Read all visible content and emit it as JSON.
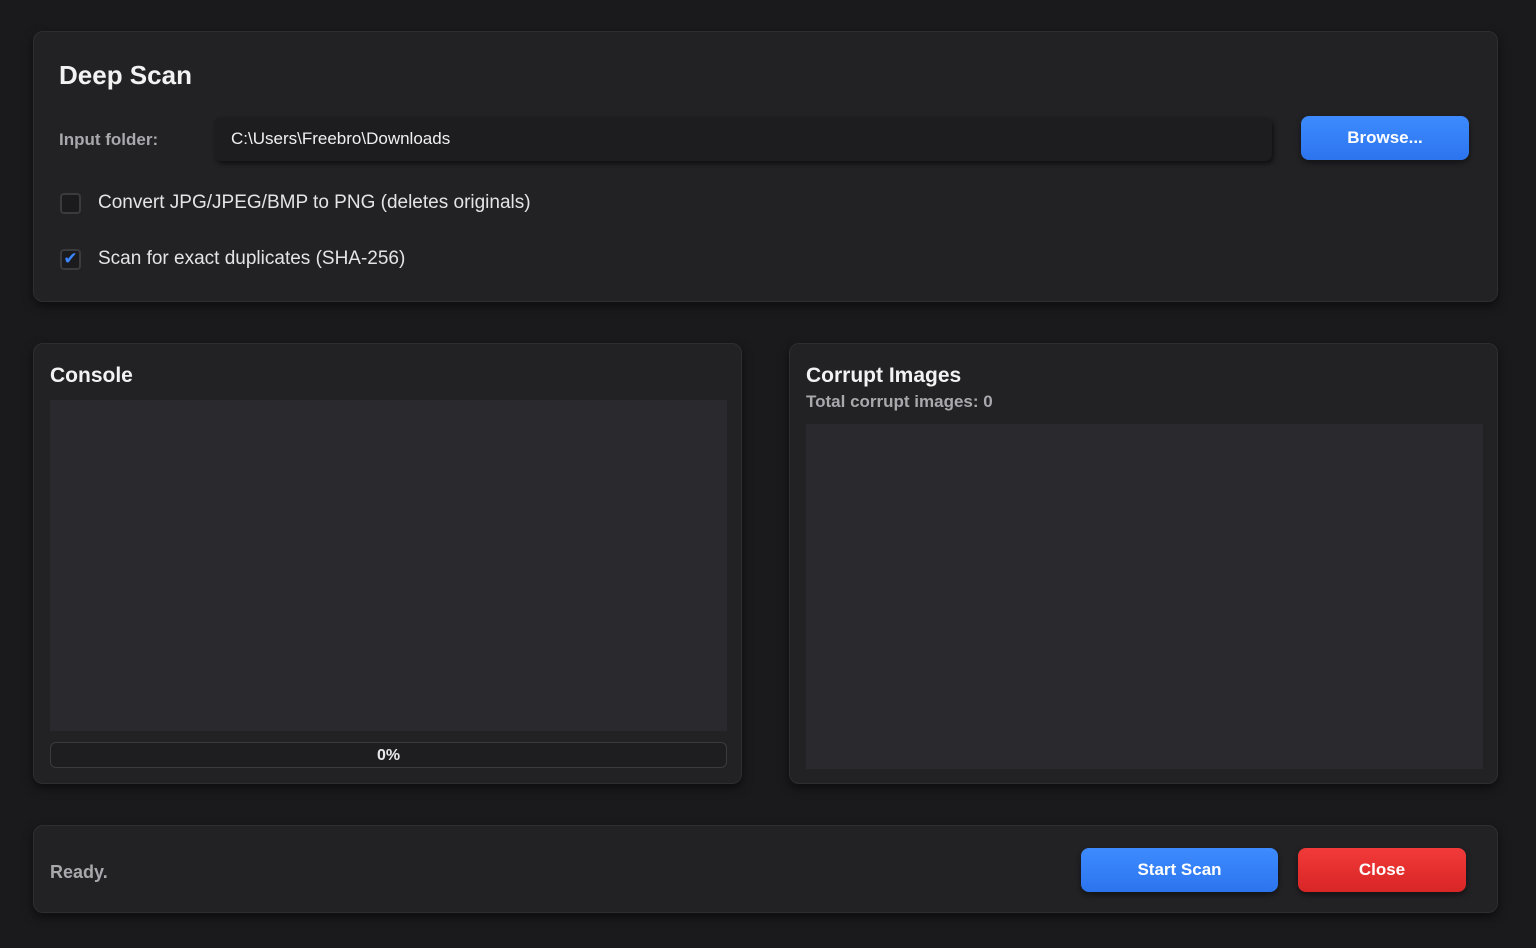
{
  "settings": {
    "title": "Deep Scan",
    "input_label": "Input folder:",
    "input_value": "C:\\Users\\Freebro\\Downloads",
    "browse_label": "Browse...",
    "convert_label": "Convert JPG/JPEG/BMP to PNG (deletes originals)",
    "convert_checked": false,
    "duplicates_label": "Scan for exact duplicates (SHA-256)",
    "duplicates_checked": true
  },
  "console": {
    "title": "Console",
    "content": "",
    "progress_value": 0,
    "progress_text": "0%"
  },
  "corrupt": {
    "title": "Corrupt Images",
    "total_text": "Total corrupt images: 0",
    "items": []
  },
  "status": {
    "text": "Ready.",
    "start_label": "Start Scan",
    "close_label": "Close"
  },
  "colors": {
    "background": "#1a1a1d",
    "card": "#222225",
    "accent_blue": "#3b86ff",
    "danger_red": "#e52f2f"
  },
  "icons": {
    "checkmark": "checkmark-icon"
  }
}
